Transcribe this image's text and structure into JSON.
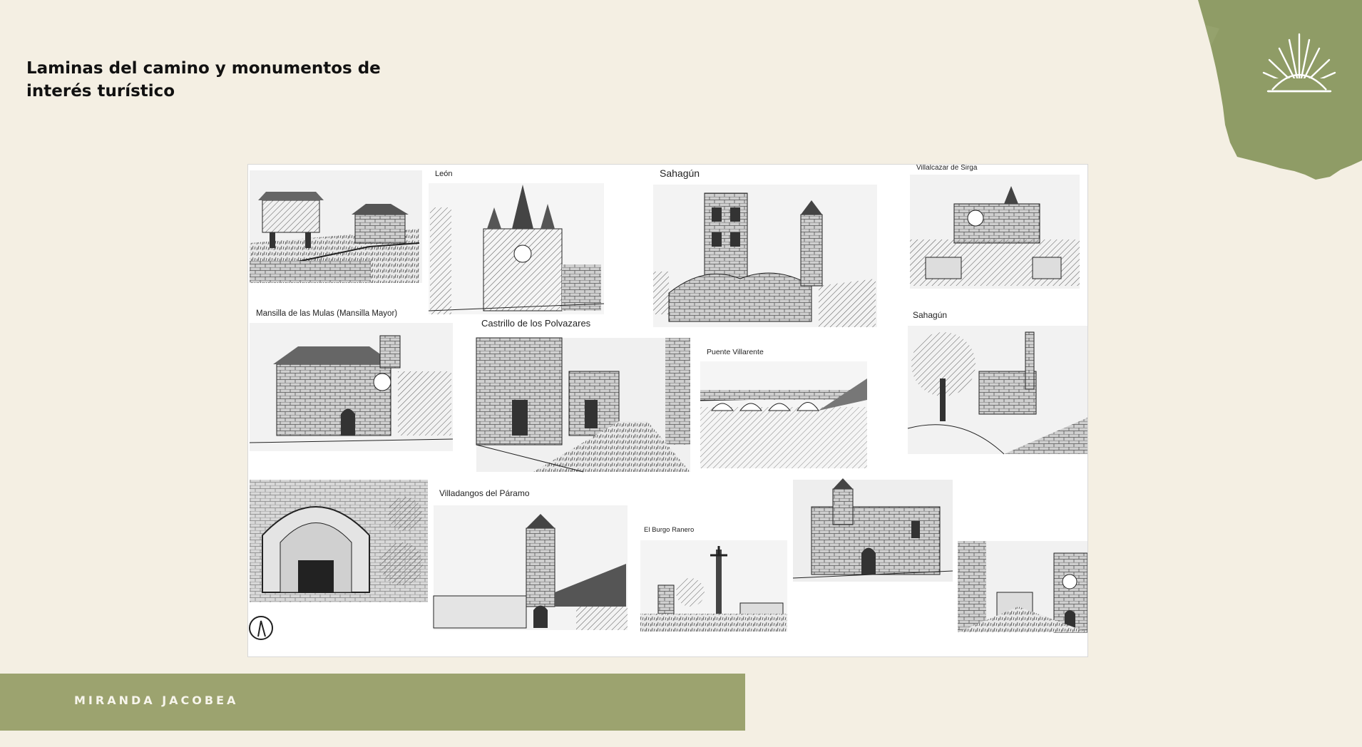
{
  "slide": {
    "title": "Laminas del camino y monumentos de interés turístico",
    "footer": "MIRANDA JACOBEA"
  },
  "collage": {
    "labels": {
      "leon": "León",
      "sahagun_top": "Sahagún",
      "villalcazar": "Villalcazar de Sirga",
      "mansilla": "Mansilla de las Mulas (Mansilla Mayor)",
      "castrillo": "Castrillo de los Polvazares",
      "puente": "Puente Villarente",
      "sahagun_right": "Sahagún",
      "villadangos": "Villadangos del Páramo",
      "burgo": "El Burgo Ranero"
    }
  },
  "colors": {
    "background": "#f4efe3",
    "accent_green": "#9ca36f",
    "corner_green": "#8f9c66"
  }
}
